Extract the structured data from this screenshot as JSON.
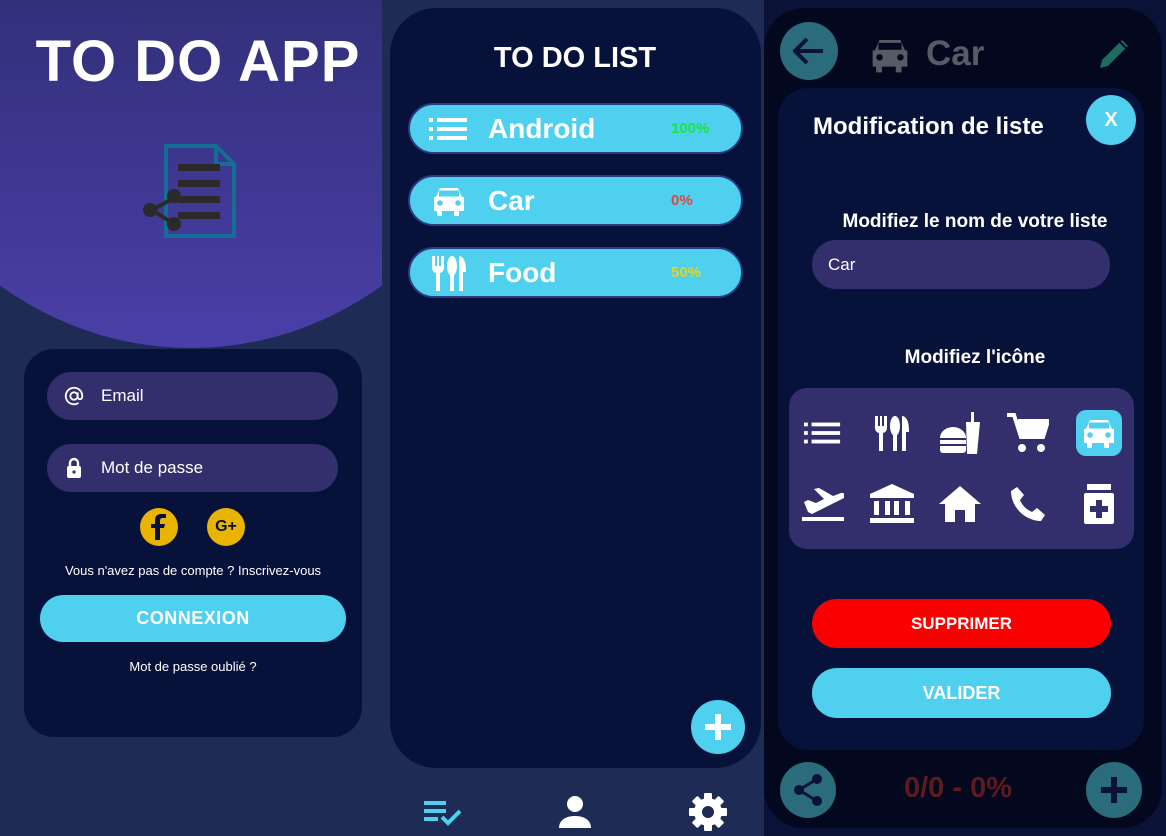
{
  "login": {
    "app_title": "TO DO APP",
    "email_placeholder": "Email",
    "password_placeholder": "Mot de passe",
    "facebook_icon": "facebook-icon",
    "google_icon": "google-plus-icon",
    "signup_text": "Vous n'avez pas de compte ? Inscrivez-vous",
    "connect_label": "CONNEXION",
    "forgot_label": "Mot de passe oublié ?"
  },
  "list": {
    "title": "TO DO LIST",
    "items": [
      {
        "name": "Android",
        "percent": "100%",
        "percent_color": "#19e53d",
        "icon": "list-icon"
      },
      {
        "name": "Car",
        "percent": "0%",
        "percent_color": "#e5443a",
        "icon": "car-icon"
      },
      {
        "name": "Food",
        "percent": "50%",
        "percent_color": "#e5d51c",
        "icon": "restaurant-icon"
      }
    ],
    "nav": [
      "checklist-icon",
      "person-icon",
      "settings-icon"
    ]
  },
  "edit": {
    "header_title": "Car",
    "dialog_title": "Modification de liste",
    "close_label": "X",
    "name_label": "Modifiez le nom de votre liste",
    "name_value": "Car",
    "icon_label": "Modifiez l'icône",
    "icons": [
      "list-icon",
      "restaurant-icon",
      "fastfood-icon",
      "cart-icon",
      "car-icon",
      "flight-icon",
      "bank-icon",
      "home-icon",
      "phone-icon",
      "pharmacy-icon"
    ],
    "selected_icon": "car-icon",
    "delete_label": "SUPPRIMER",
    "validate_label": "VALIDER",
    "progress_text": "0/0 - 0%"
  },
  "colors": {
    "accent": "#4fd0ee",
    "field": "#322f6c",
    "panel": "#07123b",
    "danger": "#fa0000"
  }
}
